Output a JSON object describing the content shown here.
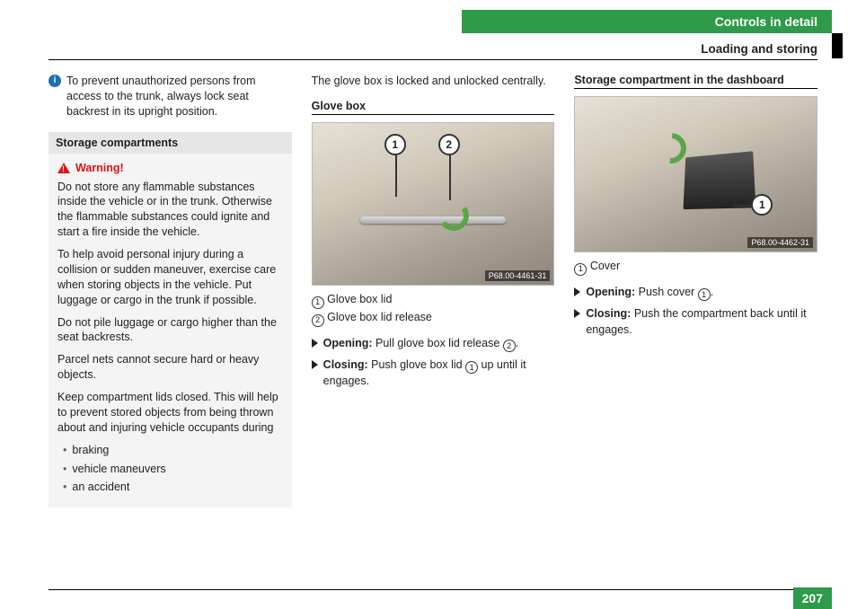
{
  "header": {
    "chapter": "Controls in detail",
    "section": "Loading and storing"
  },
  "col1": {
    "info_note": "To prevent unauthorized persons from access to the trunk, always lock seat backrest in its upright position.",
    "heading": "Storage compartments",
    "warning_label": "Warning!",
    "warning_paras": [
      "Do not store any flammable substances inside the vehicle or in the trunk. Otherwise the flammable substances could ignite and start a fire inside the vehicle.",
      "To help avoid personal injury during a collision or sudden maneuver, exercise care when storing objects in the vehicle. Put luggage or cargo in the trunk if possible.",
      "Do not pile luggage or cargo higher than the seat backrests.",
      "Parcel nets cannot secure hard or heavy objects.",
      "Keep compartment lids closed. This will help to prevent stored objects from being thrown about and injuring vehicle occupants during"
    ],
    "warning_bullets": [
      "braking",
      "vehicle maneuvers",
      "an accident"
    ]
  },
  "col2": {
    "intro": "The glove box is locked and unlocked centrally.",
    "subheading": "Glove box",
    "figure_id": "P68.00-4461-31",
    "legend": [
      {
        "num": "1",
        "text": "Glove box lid"
      },
      {
        "num": "2",
        "text": "Glove box lid release"
      }
    ],
    "actions": {
      "opening_label": "Opening:",
      "opening_text": " Pull glove box lid release ",
      "opening_ref": "2",
      "opening_tail": ".",
      "closing_label": "Closing:",
      "closing_text": " Push glove box lid ",
      "closing_ref": "1",
      "closing_tail": " up until it engages."
    }
  },
  "col3": {
    "subheading": "Storage compartment in the dashboard",
    "figure_id": "P68.00-4462-31",
    "legend": [
      {
        "num": "1",
        "text": "Cover"
      }
    ],
    "actions": {
      "opening_label": "Opening:",
      "opening_text": " Push cover ",
      "opening_ref": "1",
      "opening_tail": ".",
      "closing_label": "Closing:",
      "closing_text": " Push the compartment back until it engages.",
      "closing_ref": "",
      "closing_tail": ""
    }
  },
  "page_number": "207"
}
